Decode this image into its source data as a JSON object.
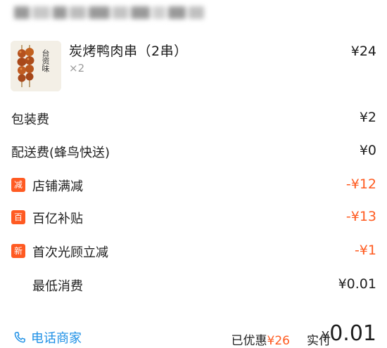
{
  "product": {
    "name": "炭烤鸭肉串（2串）",
    "quantity": "×2",
    "price": "¥24",
    "thumb_text": "台资味"
  },
  "fees": [
    {
      "label": "包装费",
      "amount": "¥2"
    },
    {
      "label": "配送费(蜂鸟快送)",
      "amount": "¥0"
    }
  ],
  "discounts": [
    {
      "badge": "减",
      "label": "店铺满减",
      "amount": "-¥12"
    },
    {
      "badge": "百",
      "label": "百亿补贴",
      "amount": "-¥13"
    },
    {
      "badge": "新",
      "label": "首次光顾立减",
      "amount": "-¥1"
    }
  ],
  "minimum": {
    "label": "最低消费",
    "amount": "¥0.01"
  },
  "footer": {
    "call_label": "电话商家",
    "saved_label": "已优惠",
    "saved_amount": "¥26",
    "paid_label": "实付",
    "paid_currency": "¥",
    "paid_amount": "0.01"
  },
  "colors": {
    "discount": "#ff5a1f",
    "badge": "#ff5a22",
    "link": "#1e90e6"
  }
}
